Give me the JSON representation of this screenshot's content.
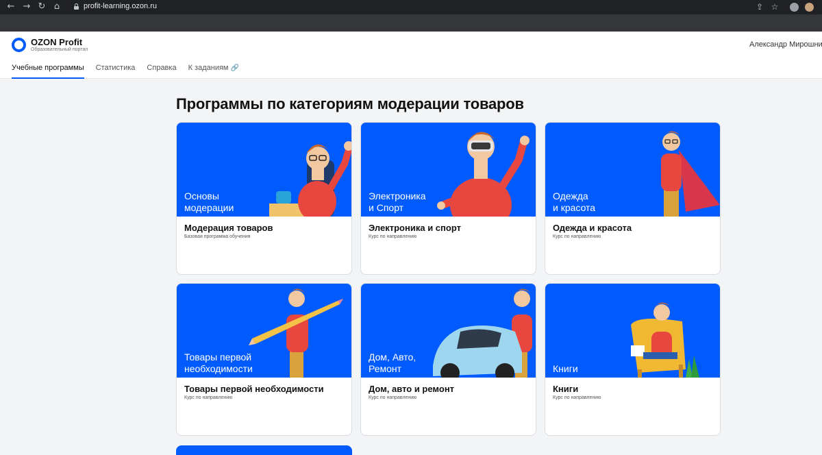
{
  "browser": {
    "url": "profit-learning.ozon.ru"
  },
  "header": {
    "brand_name": "OZON Profit",
    "brand_sub": "Образовательный портал",
    "user_name": "Александр Мирошни",
    "tabs": [
      {
        "label": "Учебные программы",
        "active": true
      },
      {
        "label": "Статистика",
        "active": false
      },
      {
        "label": "Справка",
        "active": false
      },
      {
        "label": "К заданиям",
        "active": false,
        "external": true
      }
    ]
  },
  "main": {
    "title": "Программы по категориям модерации товаров",
    "cards": [
      {
        "banner_line1": "Основы",
        "banner_line2": "модерации",
        "title": "Модерация товаров",
        "subtitle": "Базовая программа обучения"
      },
      {
        "banner_line1": "Электроника",
        "banner_line2": "и Спорт",
        "title": "Электроника и спорт",
        "subtitle": "Курс по направлению"
      },
      {
        "banner_line1": "Одежда",
        "banner_line2": "и красота",
        "title": "Одежда и красота",
        "subtitle": "Курс по направлению"
      },
      {
        "banner_line1": "Товары первой",
        "banner_line2": "необходимости",
        "title": "Товары первой необходимости",
        "subtitle": "Курс по направлению"
      },
      {
        "banner_line1": "Дом, Авто,",
        "banner_line2": "Ремонт",
        "title": "Дом, авто и ремонт",
        "subtitle": "Курс по направлению"
      },
      {
        "banner_line1": "Книги",
        "banner_line2": "",
        "title": "Книги",
        "subtitle": "Курс по направлению"
      }
    ]
  },
  "colors": {
    "brand_blue": "#005bff",
    "page_bg": "#f3f4f6"
  }
}
